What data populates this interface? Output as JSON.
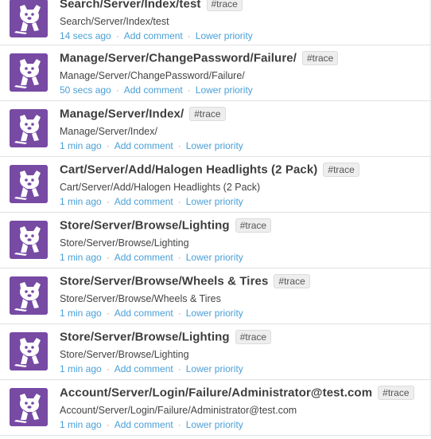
{
  "events": [
    {
      "title": "Search/Server/Index/test",
      "tag": "#trace",
      "path": "Search/Server/Index/test",
      "time": "14 secs ago",
      "comment_label": "Add comment",
      "priority_label": "Lower priority",
      "avatar_icon": "datadog-icon"
    },
    {
      "title": "Manage/Server/ChangePassword/Failure/",
      "tag": "#trace",
      "path": "Manage/Server/ChangePassword/Failure/",
      "time": "50 secs ago",
      "comment_label": "Add comment",
      "priority_label": "Lower priority",
      "avatar_icon": "datadog-icon"
    },
    {
      "title": "Manage/Server/Index/",
      "tag": "#trace",
      "path": "Manage/Server/Index/",
      "time": "1 min ago",
      "comment_label": "Add comment",
      "priority_label": "Lower priority",
      "avatar_icon": "datadog-icon"
    },
    {
      "title": "Cart/Server/Add/Halogen Headlights (2 Pack)",
      "tag": "#trace",
      "path": "Cart/Server/Add/Halogen Headlights (2 Pack)",
      "time": "1 min ago",
      "comment_label": "Add comment",
      "priority_label": "Lower priority",
      "avatar_icon": "datadog-icon"
    },
    {
      "title": "Store/Server/Browse/Lighting",
      "tag": "#trace",
      "path": "Store/Server/Browse/Lighting",
      "time": "1 min ago",
      "comment_label": "Add comment",
      "priority_label": "Lower priority",
      "avatar_icon": "datadog-icon"
    },
    {
      "title": "Store/Server/Browse/Wheels & Tires",
      "tag": "#trace",
      "path": "Store/Server/Browse/Wheels & Tires",
      "time": "1 min ago",
      "comment_label": "Add comment",
      "priority_label": "Lower priority",
      "avatar_icon": "datadog-icon"
    },
    {
      "title": "Store/Server/Browse/Lighting",
      "tag": "#trace",
      "path": "Store/Server/Browse/Lighting",
      "time": "1 min ago",
      "comment_label": "Add comment",
      "priority_label": "Lower priority",
      "avatar_icon": "datadog-icon"
    },
    {
      "title": "Account/Server/Login/Failure/Administrator@test.com",
      "tag": "#trace",
      "path": "Account/Server/Login/Failure/Administrator@test.com",
      "time": "1 min ago",
      "comment_label": "Add comment",
      "priority_label": "Lower priority",
      "avatar_icon": "datadog-icon"
    }
  ],
  "meta_separator": "·",
  "colors": {
    "avatar_bg": "#774aa4",
    "link": "#4a9fd6",
    "title": "#3d3d3d"
  }
}
